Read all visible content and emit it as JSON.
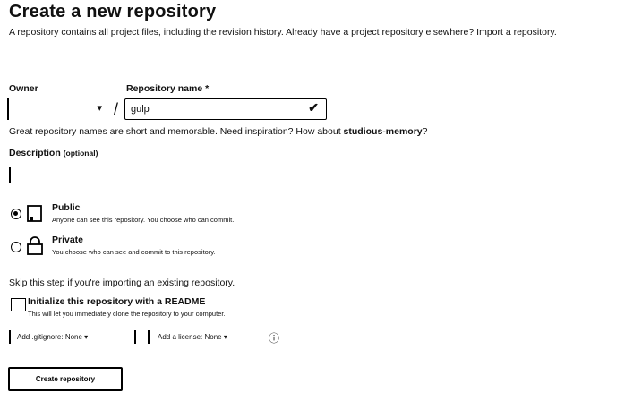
{
  "page": {
    "title": "Create a new repository",
    "intro": "A repository contains all project files, including the revision history. Already have a project repository elsewhere? Import a repository."
  },
  "owner": {
    "label": "Owner",
    "value": "",
    "caret": "▾"
  },
  "separator": "/",
  "repository": {
    "label": "Repository name *",
    "value": "gulp",
    "valid_mark": "✔"
  },
  "name_hint": {
    "text": "Great repository names are short and memorable. Need inspiration? How about ",
    "suggestion": "studious-memory",
    "end": "?"
  },
  "description": {
    "label": "Description",
    "optional": "(optional)",
    "value": ""
  },
  "visibility": {
    "public": {
      "title": "Public",
      "desc": "Anyone can see this repository. You choose who can commit.",
      "icon": "repo-icon",
      "selected": true
    },
    "private": {
      "title": "Private",
      "desc": "You choose who can see and commit to this repository.",
      "icon": "lock-icon",
      "selected": false
    }
  },
  "init": {
    "skip_text": "Skip this step if you're importing an existing repository.",
    "readme_label": "Initialize this repository with a README",
    "readme_desc": "This will let you immediately clone the repository to your computer.",
    "checked": false
  },
  "gitignore": {
    "label": "Add .gitignore: None ▾"
  },
  "license": {
    "label": "Add a license: None ▾"
  },
  "info_icon": "ⓘ",
  "create_button": "Create repository"
}
